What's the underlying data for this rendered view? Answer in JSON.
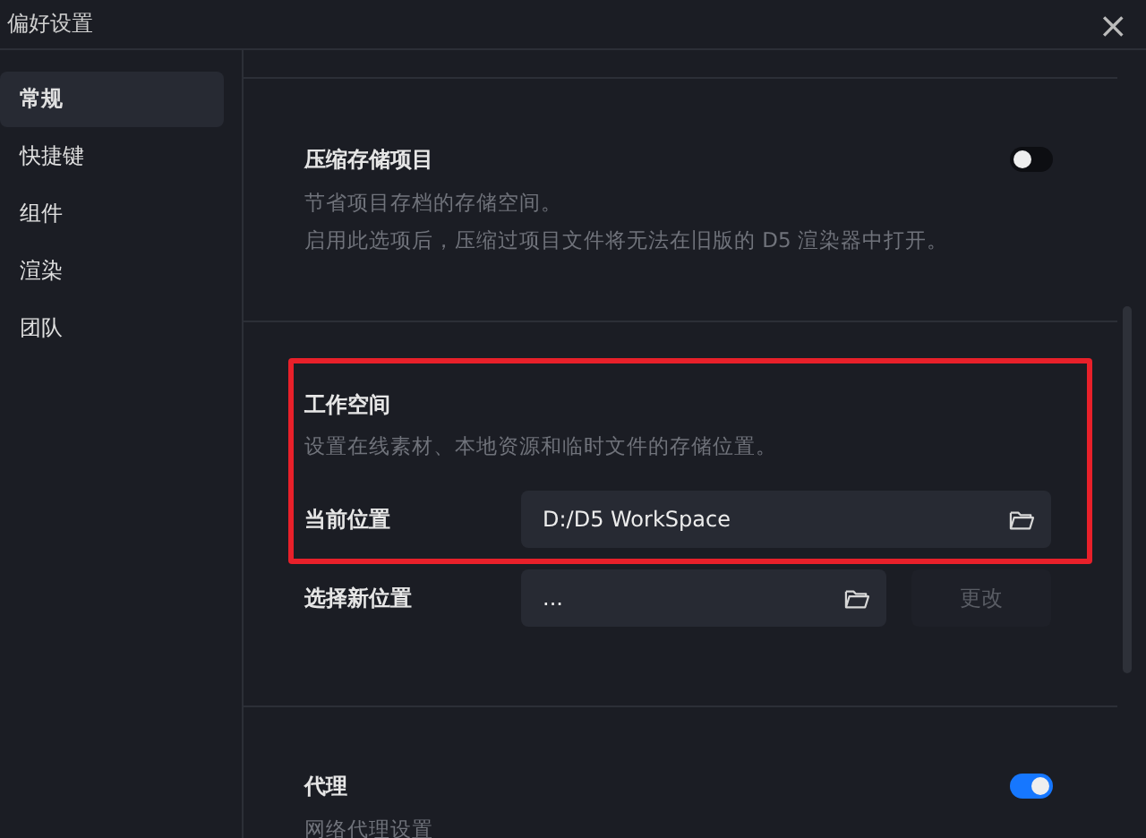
{
  "window": {
    "title": "偏好设置",
    "close": "×"
  },
  "sidebar": {
    "items": [
      {
        "label": "常规",
        "selected": true
      },
      {
        "label": "快捷键",
        "selected": false
      },
      {
        "label": "组件",
        "selected": false
      },
      {
        "label": "渲染",
        "selected": false
      },
      {
        "label": "团队",
        "selected": false
      }
    ]
  },
  "sections": [
    {
      "kind": "toggle",
      "title": "压缩存储项目",
      "on": false,
      "description": [
        "节省项目存档的存储空间。",
        "启用此选项后，压缩过项目文件将无法在旧版的 D5 渲染器中打开。"
      ]
    },
    {
      "kind": "location",
      "title": "工作空间",
      "highlighted": true,
      "description": [
        "设置在线素材、本地资源和临时文件的存储位置。"
      ],
      "current": {
        "label": "当前位置",
        "value": "D:/D5 WorkSpace"
      },
      "new": {
        "label": "选择新位置",
        "value": "...",
        "button": "更改",
        "button_disabled": true
      }
    },
    {
      "kind": "toggle",
      "title": "代理",
      "on": true,
      "description": [
        "网络代理设置"
      ]
    }
  ]
}
